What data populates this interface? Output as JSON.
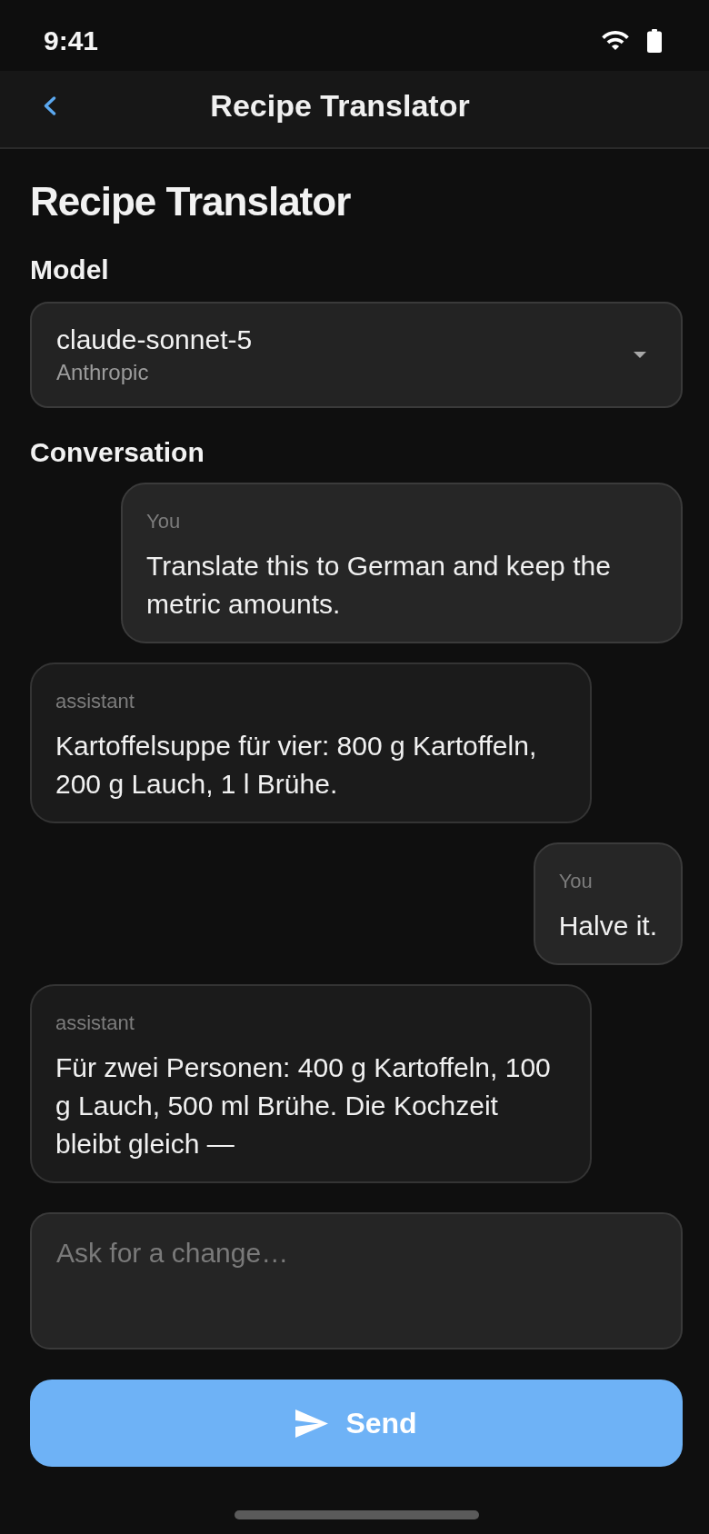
{
  "status_bar": {
    "time": "9:41"
  },
  "nav_bar": {
    "title": "Recipe Translator"
  },
  "page_title": "Recipe Translator",
  "model_field": {
    "label": "Model",
    "value": "claude-sonnet-5",
    "provider": "Anthropic"
  },
  "conversation": {
    "label": "Conversation",
    "messages": [
      {
        "kind": "user",
        "sender": "You",
        "text": "Translate this to German and keep the metric amounts."
      },
      {
        "kind": "assistant",
        "sender": "assistant",
        "text": "Kartoffelsuppe für vier: 800 g Kartoffeln, 200 g Lauch, 1 l Brühe."
      },
      {
        "kind": "user",
        "sender": "You",
        "text": "Halve it."
      },
      {
        "kind": "assistant",
        "sender": "assistant",
        "text": "Für zwei Personen: 400 g Kartoffeln, 100 g Lauch, 500 ml Brühe. Die Kochzeit bleibt gleich —"
      }
    ]
  },
  "composer": {
    "placeholder": "Ask for a change…"
  },
  "send_button": {
    "label": "Send"
  }
}
